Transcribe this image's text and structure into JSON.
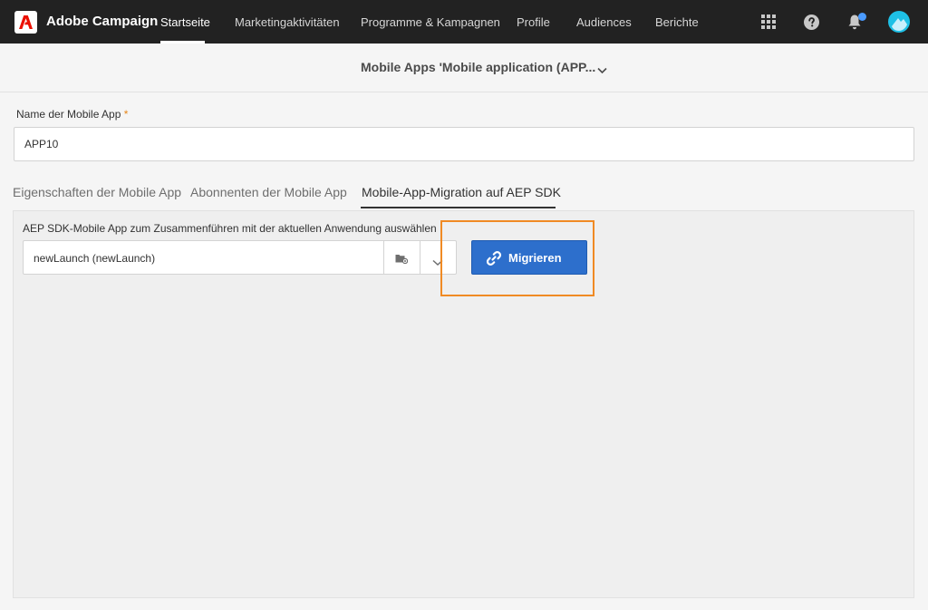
{
  "app": {
    "brand": "Adobe Campaign",
    "nav": [
      "Startseite",
      "Marketingaktivitäten",
      "Programme & Kampagnen",
      "Profile",
      "Audiences",
      "Berichte"
    ],
    "active_nav": "Startseite",
    "icons": [
      "grid-icon",
      "help-icon",
      "notification-bell-icon",
      "user-avatar-icon"
    ]
  },
  "header": {
    "title": "Mobile Apps 'Mobile application (APP..."
  },
  "form": {
    "name_label": "Name der Mobile App",
    "required_mark": "*",
    "name_value": "APP10"
  },
  "tabs": [
    "Eigenschaften der Mobile App",
    "Abonnenten der Mobile App",
    "Mobile-App-Migration auf AEP SDK"
  ],
  "active_tab": "Mobile-App-Migration auf AEP SDK",
  "migration": {
    "label": "AEP SDK-Mobile App zum Zusammenführen mit der aktuellen Anwendung auswählen",
    "selected_app": "newLaunch (newLaunch)",
    "button_label": "Migrieren"
  },
  "colors": {
    "topbar": "#222222",
    "brand_red": "#eb1000",
    "primary_button": "#2d6fcc",
    "highlight": "#f08a24",
    "notification_dot": "#4a9bff",
    "avatar": "#1ec0e6"
  }
}
